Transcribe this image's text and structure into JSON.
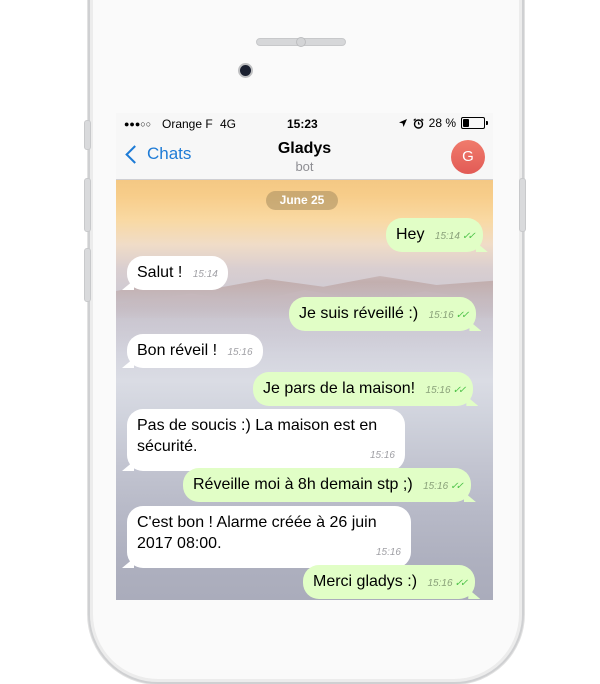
{
  "status_bar": {
    "signal": "●●●○○",
    "carrier": "Orange F",
    "network": "4G",
    "time": "15:23",
    "battery": "28 %",
    "battery_level": 0.28,
    "icons": [
      "location-arrow-icon",
      "alarm-clock-icon",
      "battery-icon"
    ]
  },
  "nav": {
    "back_label": "Chats",
    "title": "Gladys",
    "subtitle": "bot",
    "avatar_letter": "G"
  },
  "chat": {
    "date": "June 25",
    "messages": [
      {
        "dir": "out",
        "text": "Hey",
        "time": "15:14"
      },
      {
        "dir": "in",
        "text": "Salut !",
        "time": "15:14"
      },
      {
        "dir": "out",
        "text": "Je suis réveillé :)",
        "time": "15:16"
      },
      {
        "dir": "in",
        "text": "Bon réveil !",
        "time": "15:16"
      },
      {
        "dir": "out",
        "text": "Je pars de la maison!",
        "time": "15:16"
      },
      {
        "dir": "in",
        "text": "Pas de soucis :) La maison est en sécurité.",
        "time": "15:16"
      },
      {
        "dir": "out",
        "text": "Réveille moi à 8h demain stp ;)",
        "time": "15:16"
      },
      {
        "dir": "in",
        "text": "C'est bon ! Alarme créée à 26 juin 2017 08:00.",
        "time": "15:16"
      },
      {
        "dir": "out",
        "text": "Merci gladys :)",
        "time": "15:16"
      }
    ],
    "check_mark": "✓✓"
  },
  "colors": {
    "accent": "#1e7bd6",
    "bubble_out": "#e1fec6",
    "bubble_in": "#ffffff",
    "avatar": "#e8655d",
    "read_ticks": "#4fc34a"
  }
}
